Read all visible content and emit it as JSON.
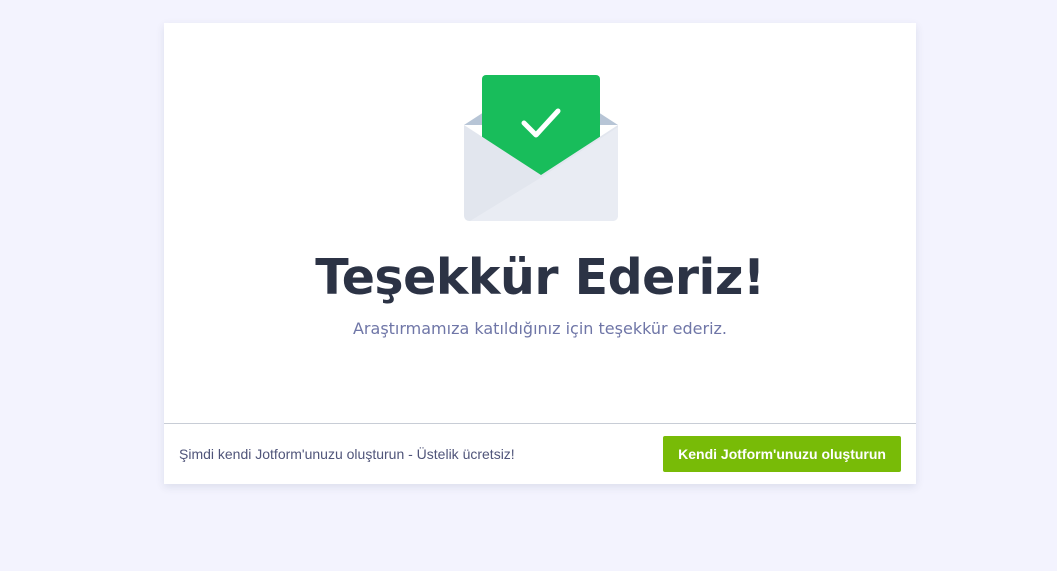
{
  "thank_you": {
    "title": "Teşekkür Ederiz!",
    "message": "Araştırmamıza katıldığınız için teşekkür ederiz.",
    "icon": "envelope-check-icon"
  },
  "footer": {
    "promo_text": "Şimdi kendi Jotform'unuzu oluşturun - Üstelik ücretsiz!",
    "button_label": "Kendi Jotform'unuzu oluşturun"
  },
  "colors": {
    "page_background": "#f3f3fe",
    "card_background": "#ffffff",
    "check_green": "#18bd5b",
    "button_green": "#78bb07",
    "title_color": "#2c3345",
    "subtitle_color": "#6f76a7"
  }
}
